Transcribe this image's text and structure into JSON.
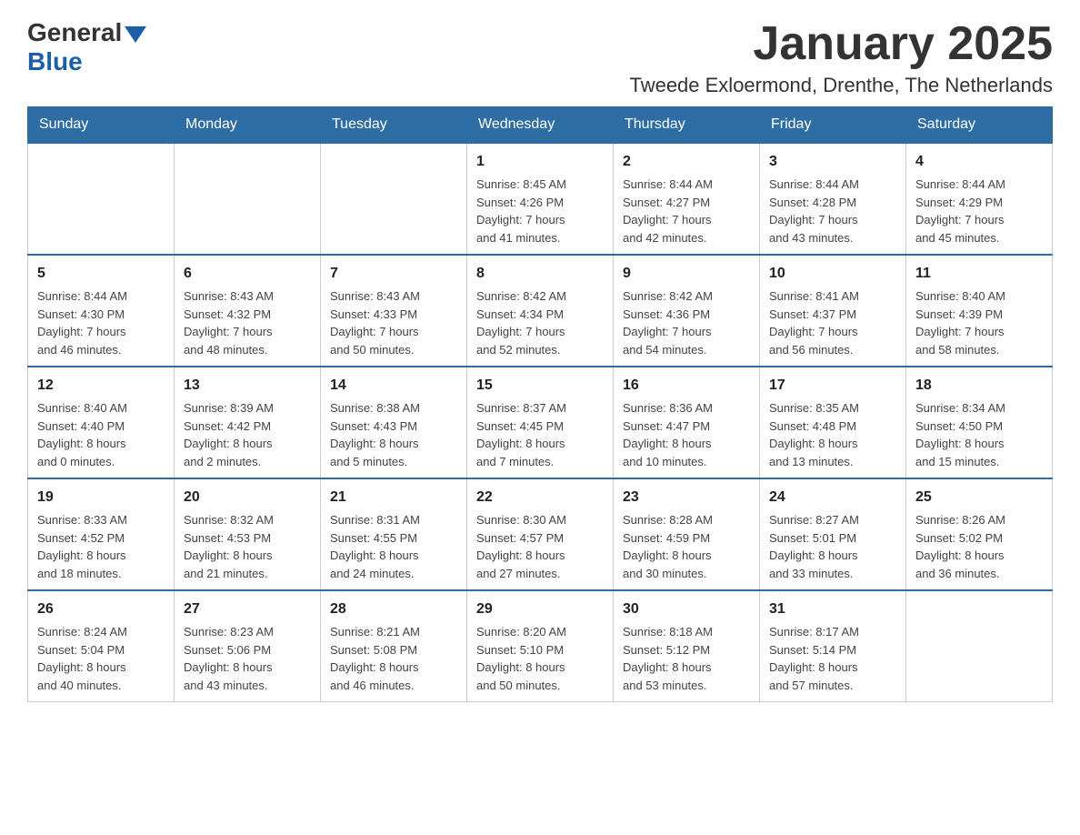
{
  "logo": {
    "general": "General",
    "blue": "Blue"
  },
  "header": {
    "title": "January 2025",
    "subtitle": "Tweede Exloermond, Drenthe, The Netherlands"
  },
  "weekdays": [
    "Sunday",
    "Monday",
    "Tuesday",
    "Wednesday",
    "Thursday",
    "Friday",
    "Saturday"
  ],
  "weeks": [
    [
      {
        "day": "",
        "info": ""
      },
      {
        "day": "",
        "info": ""
      },
      {
        "day": "",
        "info": ""
      },
      {
        "day": "1",
        "info": "Sunrise: 8:45 AM\nSunset: 4:26 PM\nDaylight: 7 hours\nand 41 minutes."
      },
      {
        "day": "2",
        "info": "Sunrise: 8:44 AM\nSunset: 4:27 PM\nDaylight: 7 hours\nand 42 minutes."
      },
      {
        "day": "3",
        "info": "Sunrise: 8:44 AM\nSunset: 4:28 PM\nDaylight: 7 hours\nand 43 minutes."
      },
      {
        "day": "4",
        "info": "Sunrise: 8:44 AM\nSunset: 4:29 PM\nDaylight: 7 hours\nand 45 minutes."
      }
    ],
    [
      {
        "day": "5",
        "info": "Sunrise: 8:44 AM\nSunset: 4:30 PM\nDaylight: 7 hours\nand 46 minutes."
      },
      {
        "day": "6",
        "info": "Sunrise: 8:43 AM\nSunset: 4:32 PM\nDaylight: 7 hours\nand 48 minutes."
      },
      {
        "day": "7",
        "info": "Sunrise: 8:43 AM\nSunset: 4:33 PM\nDaylight: 7 hours\nand 50 minutes."
      },
      {
        "day": "8",
        "info": "Sunrise: 8:42 AM\nSunset: 4:34 PM\nDaylight: 7 hours\nand 52 minutes."
      },
      {
        "day": "9",
        "info": "Sunrise: 8:42 AM\nSunset: 4:36 PM\nDaylight: 7 hours\nand 54 minutes."
      },
      {
        "day": "10",
        "info": "Sunrise: 8:41 AM\nSunset: 4:37 PM\nDaylight: 7 hours\nand 56 minutes."
      },
      {
        "day": "11",
        "info": "Sunrise: 8:40 AM\nSunset: 4:39 PM\nDaylight: 7 hours\nand 58 minutes."
      }
    ],
    [
      {
        "day": "12",
        "info": "Sunrise: 8:40 AM\nSunset: 4:40 PM\nDaylight: 8 hours\nand 0 minutes."
      },
      {
        "day": "13",
        "info": "Sunrise: 8:39 AM\nSunset: 4:42 PM\nDaylight: 8 hours\nand 2 minutes."
      },
      {
        "day": "14",
        "info": "Sunrise: 8:38 AM\nSunset: 4:43 PM\nDaylight: 8 hours\nand 5 minutes."
      },
      {
        "day": "15",
        "info": "Sunrise: 8:37 AM\nSunset: 4:45 PM\nDaylight: 8 hours\nand 7 minutes."
      },
      {
        "day": "16",
        "info": "Sunrise: 8:36 AM\nSunset: 4:47 PM\nDaylight: 8 hours\nand 10 minutes."
      },
      {
        "day": "17",
        "info": "Sunrise: 8:35 AM\nSunset: 4:48 PM\nDaylight: 8 hours\nand 13 minutes."
      },
      {
        "day": "18",
        "info": "Sunrise: 8:34 AM\nSunset: 4:50 PM\nDaylight: 8 hours\nand 15 minutes."
      }
    ],
    [
      {
        "day": "19",
        "info": "Sunrise: 8:33 AM\nSunset: 4:52 PM\nDaylight: 8 hours\nand 18 minutes."
      },
      {
        "day": "20",
        "info": "Sunrise: 8:32 AM\nSunset: 4:53 PM\nDaylight: 8 hours\nand 21 minutes."
      },
      {
        "day": "21",
        "info": "Sunrise: 8:31 AM\nSunset: 4:55 PM\nDaylight: 8 hours\nand 24 minutes."
      },
      {
        "day": "22",
        "info": "Sunrise: 8:30 AM\nSunset: 4:57 PM\nDaylight: 8 hours\nand 27 minutes."
      },
      {
        "day": "23",
        "info": "Sunrise: 8:28 AM\nSunset: 4:59 PM\nDaylight: 8 hours\nand 30 minutes."
      },
      {
        "day": "24",
        "info": "Sunrise: 8:27 AM\nSunset: 5:01 PM\nDaylight: 8 hours\nand 33 minutes."
      },
      {
        "day": "25",
        "info": "Sunrise: 8:26 AM\nSunset: 5:02 PM\nDaylight: 8 hours\nand 36 minutes."
      }
    ],
    [
      {
        "day": "26",
        "info": "Sunrise: 8:24 AM\nSunset: 5:04 PM\nDaylight: 8 hours\nand 40 minutes."
      },
      {
        "day": "27",
        "info": "Sunrise: 8:23 AM\nSunset: 5:06 PM\nDaylight: 8 hours\nand 43 minutes."
      },
      {
        "day": "28",
        "info": "Sunrise: 8:21 AM\nSunset: 5:08 PM\nDaylight: 8 hours\nand 46 minutes."
      },
      {
        "day": "29",
        "info": "Sunrise: 8:20 AM\nSunset: 5:10 PM\nDaylight: 8 hours\nand 50 minutes."
      },
      {
        "day": "30",
        "info": "Sunrise: 8:18 AM\nSunset: 5:12 PM\nDaylight: 8 hours\nand 53 minutes."
      },
      {
        "day": "31",
        "info": "Sunrise: 8:17 AM\nSunset: 5:14 PM\nDaylight: 8 hours\nand 57 minutes."
      },
      {
        "day": "",
        "info": ""
      }
    ]
  ]
}
